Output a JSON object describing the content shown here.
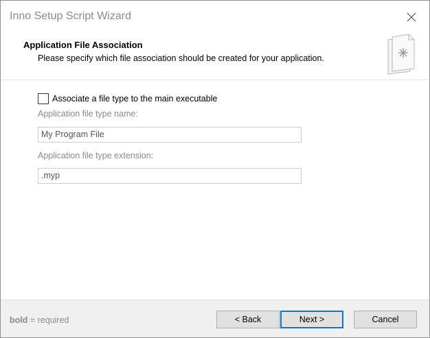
{
  "window": {
    "title": "Inno Setup Script Wizard"
  },
  "header": {
    "title": "Application File Association",
    "subtitle": "Please specify which file association should be created for your application.",
    "icon": "document-icon"
  },
  "form": {
    "associate_checkbox": {
      "label": "Associate a file type to the main executable",
      "checked": false
    },
    "file_type_name": {
      "label": "Application file type name:",
      "value": "My Program File"
    },
    "file_type_extension": {
      "label": "Application file type extension:",
      "value": ".myp"
    }
  },
  "footer": {
    "hint_bold": "bold",
    "hint_rest": " = required",
    "back_label": "< Back",
    "next_label": "Next >",
    "cancel_label": "Cancel"
  }
}
